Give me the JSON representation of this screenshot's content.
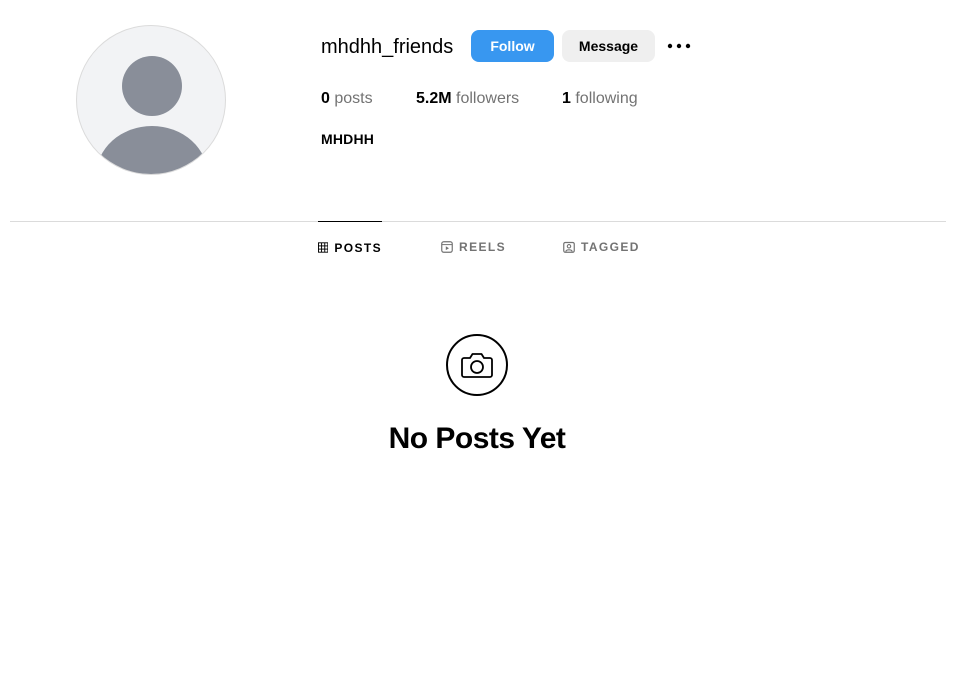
{
  "profile": {
    "username": "mhdhh_friends",
    "full_name": "MHDHH",
    "avatar_icon": "default-avatar-icon"
  },
  "actions": {
    "follow_label": "Follow",
    "message_label": "Message",
    "more_icon": "more-options-icon"
  },
  "stats": {
    "posts_count": "0",
    "posts_label": "posts",
    "followers_count": "5.2M",
    "followers_label": "followers",
    "following_count": "1",
    "following_label": "following"
  },
  "tabs": [
    {
      "label": "POSTS",
      "icon": "grid-icon",
      "active": true
    },
    {
      "label": "REELS",
      "icon": "reels-icon",
      "active": false
    },
    {
      "label": "TAGGED",
      "icon": "tagged-icon",
      "active": false
    }
  ],
  "empty_state": {
    "icon": "camera-icon",
    "title": "No Posts Yet"
  },
  "colors": {
    "follow_button": "#3897f0",
    "message_button": "#efefef",
    "muted_text": "#737373",
    "divider": "#dbdbdb"
  }
}
